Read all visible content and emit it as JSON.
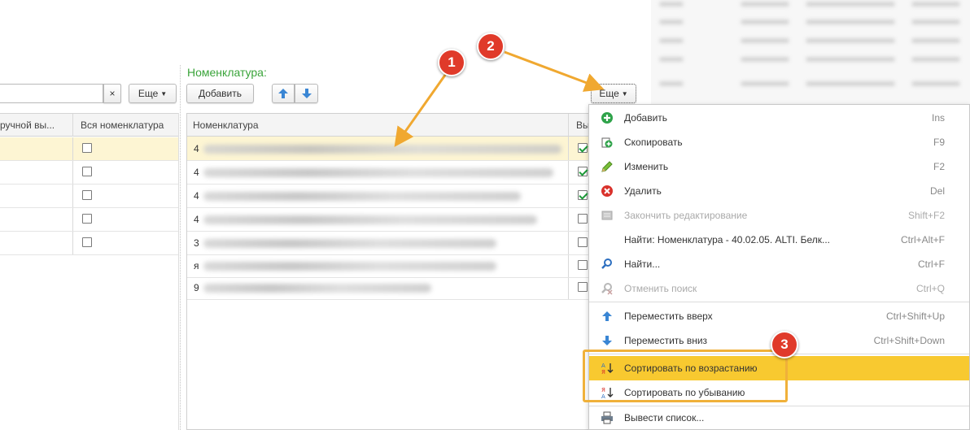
{
  "left_panel": {
    "more_button": "Еще",
    "clear_icon": "×",
    "columns": [
      "ручной вы...",
      "Вся номенклатура"
    ]
  },
  "nomenclature": {
    "title": "Номенклатура:",
    "add_button": "Добавить",
    "more_button": "Еще",
    "column_header": "Номенклатура",
    "column_header_2": "Вы",
    "row_prefixes": [
      "4",
      "4",
      "4",
      "4",
      "3",
      "я",
      "9"
    ]
  },
  "menu": {
    "items": [
      {
        "icon": "add-icon",
        "label": "Добавить",
        "shortcut": "Ins"
      },
      {
        "icon": "copy-icon",
        "label": "Скопировать",
        "shortcut": "F9"
      },
      {
        "icon": "edit-pencil-icon",
        "label": "Изменить",
        "shortcut": "F2"
      },
      {
        "icon": "delete-icon",
        "label": "Удалить",
        "shortcut": "Del"
      },
      {
        "icon": "end-edit-icon",
        "label": "Закончить редактирование",
        "shortcut": "Shift+F2"
      },
      {
        "icon": "",
        "label": "Найти: Номенклатура - 40.02.05. ALTI. Белк...",
        "shortcut": "Ctrl+Alt+F"
      },
      {
        "icon": "search-icon",
        "label": "Найти...",
        "shortcut": "Ctrl+F"
      },
      {
        "icon": "cancel-search-icon",
        "label": "Отменить поиск",
        "shortcut": "Ctrl+Q"
      },
      {
        "icon": "arrow-up-icon",
        "label": "Переместить вверх",
        "shortcut": "Ctrl+Shift+Up"
      },
      {
        "icon": "arrow-down-icon",
        "label": "Переместить вниз",
        "shortcut": "Ctrl+Shift+Down"
      },
      {
        "icon": "sort-ascending-icon",
        "label": "Сортировать по возрастанию",
        "shortcut": ""
      },
      {
        "icon": "sort-descending-icon",
        "label": "Сортировать по убыванию",
        "shortcut": ""
      },
      {
        "icon": "print-list-icon",
        "label": "Вывести список...",
        "shortcut": ""
      }
    ]
  },
  "badges": [
    "1",
    "2",
    "3"
  ],
  "colors": {
    "title_green": "#3aa43a",
    "highlight": "#f8c930",
    "selected_row": "#fdf5d3",
    "badge_red": "#e03a2a",
    "arrow_orange": "#f0a830"
  }
}
